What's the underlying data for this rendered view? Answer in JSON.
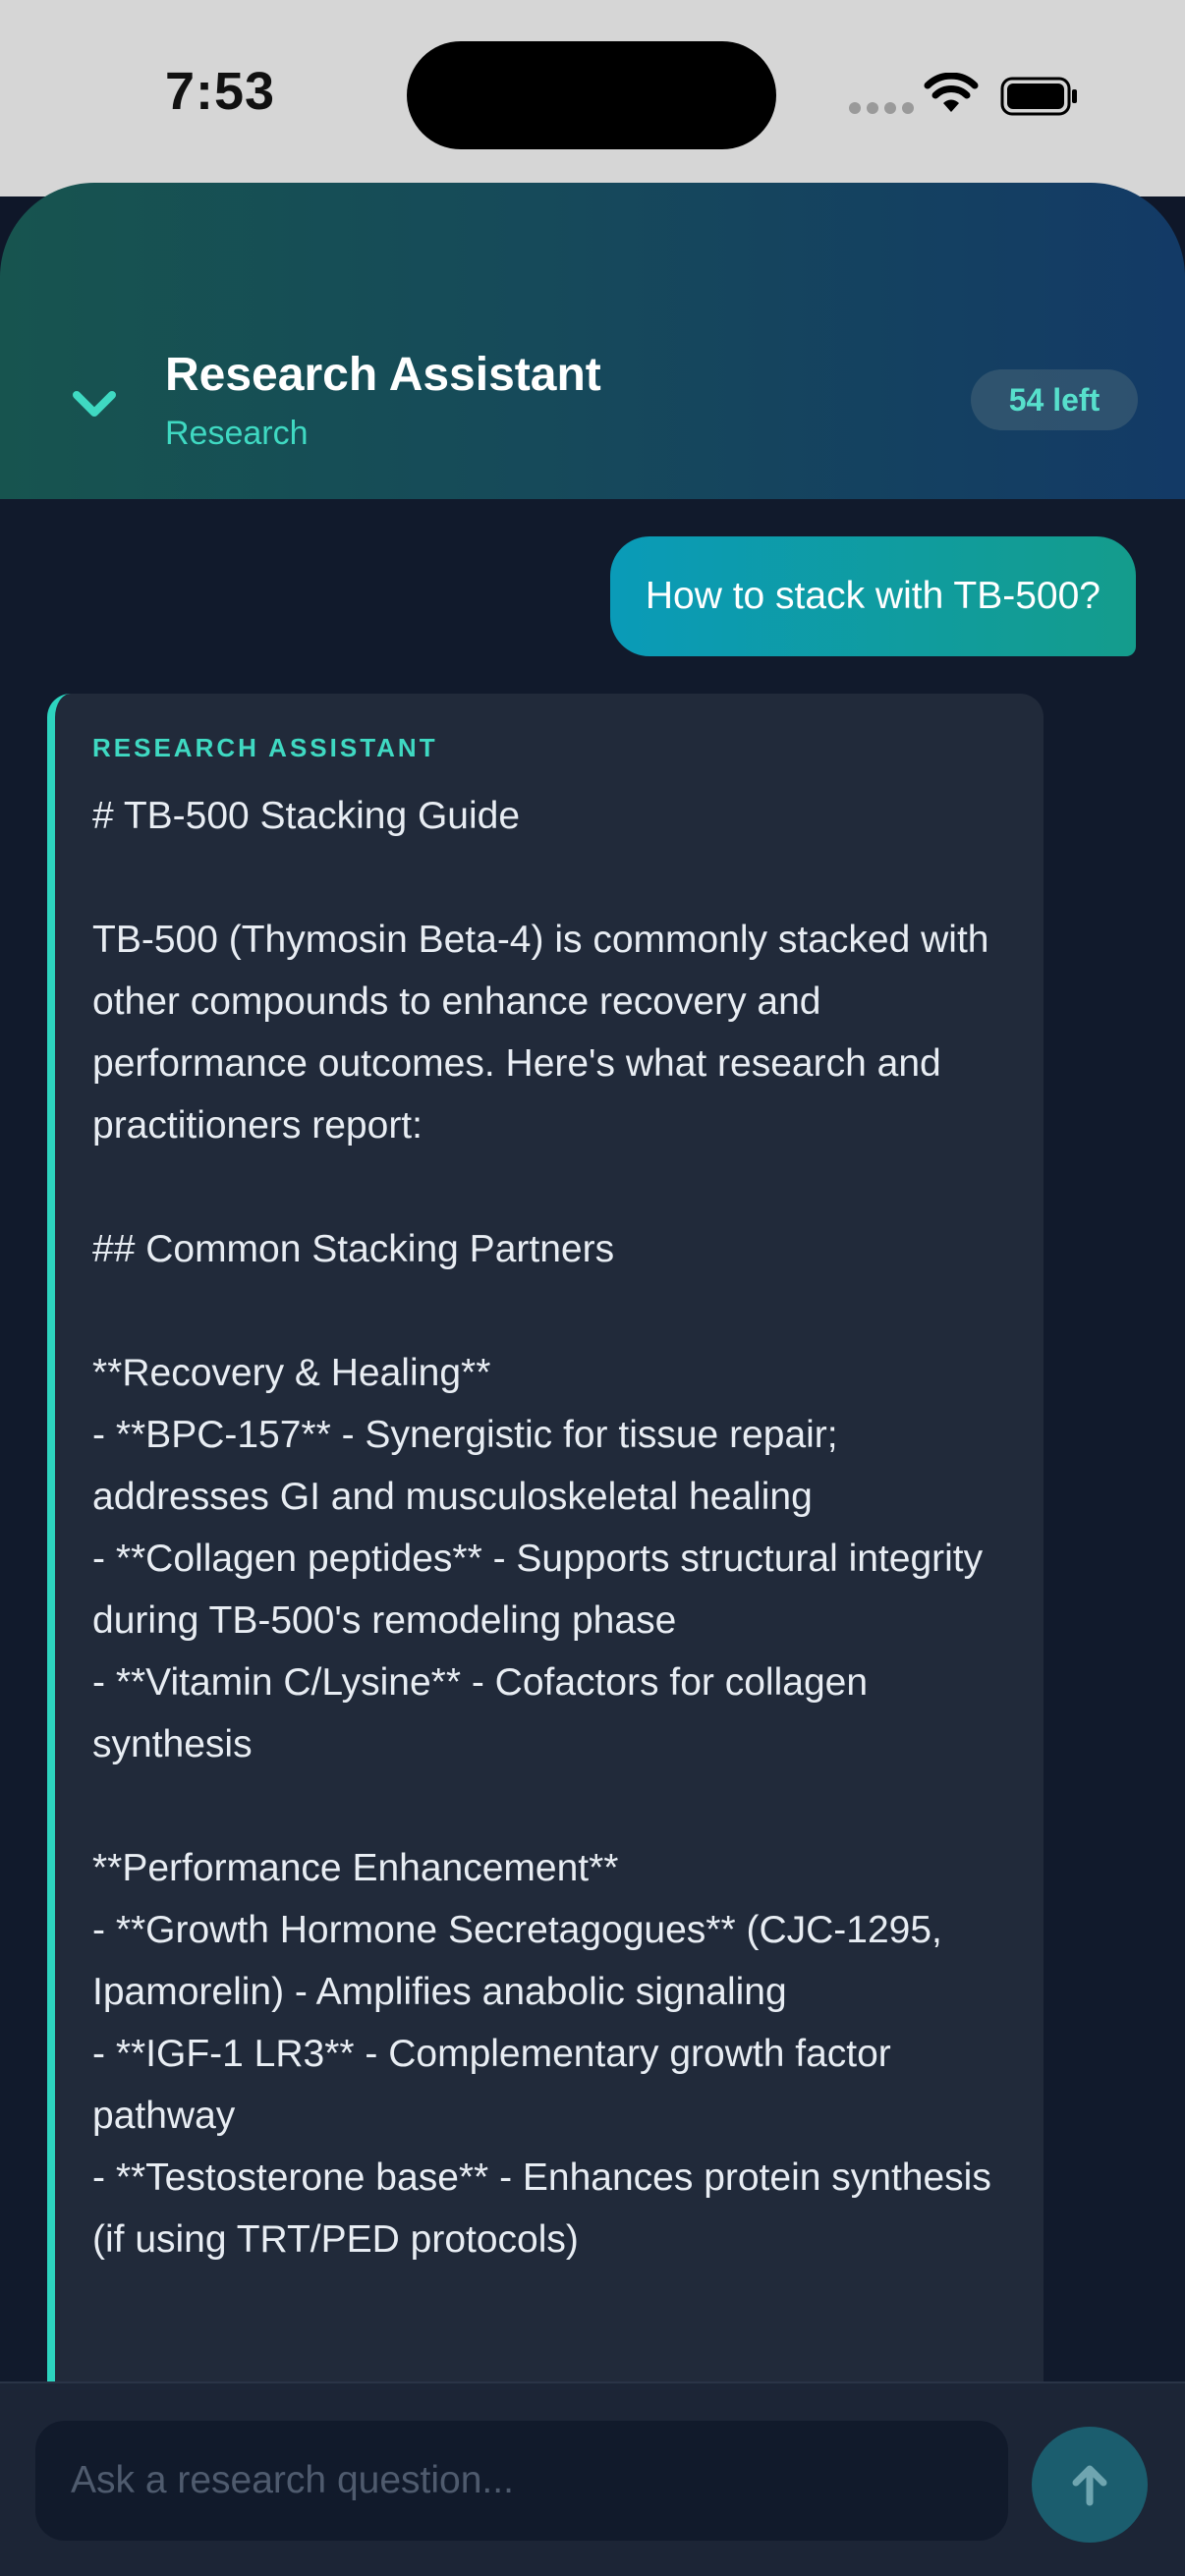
{
  "status_bar": {
    "time": "7:53",
    "icons": [
      "cellular-signal-icon",
      "wifi-icon",
      "battery-icon"
    ]
  },
  "header": {
    "back_icon": "chevron-down-icon",
    "title": "Research Assistant",
    "subtitle": "Research",
    "credits": "54 left"
  },
  "chat": {
    "user_message": "How to stack with TB-500?",
    "assistant_label": "RESEARCH ASSISTANT",
    "assistant_message": "# TB-500 Stacking Guide\n\nTB-500 (Thymosin Beta-4) is commonly stacked with other compounds to enhance recovery and performance outcomes. Here's what research and practitioners report:\n\n## Common Stacking Partners\n\n**Recovery & Healing**\n- **BPC-157** - Synergistic for tissue repair; addresses GI and musculoskeletal healing\n- **Collagen peptides** - Supports structural integrity during TB-500's remodeling phase\n- **Vitamin C/Lysine** - Cofactors for collagen synthesis\n\n**Performance Enhancement**\n- **Growth Hormone Secretagogues** (CJC-1295, Ipamorelin) - Amplifies anabolic signaling\n- **IGF-1 LR3** - Complementary growth factor pathway\n- **Testosterone base** - Enhances protein synthesis (if using TRT/PED protocols)"
  },
  "composer": {
    "placeholder": "Ask a research question...",
    "value": "",
    "send_icon": "arrow-up-icon"
  },
  "colors": {
    "accent": "#2dd4bf",
    "background": "#111a2c",
    "card": "#212a3a",
    "user_bubble_start": "#0a9bb8",
    "user_bubble_end": "#149c8c"
  }
}
